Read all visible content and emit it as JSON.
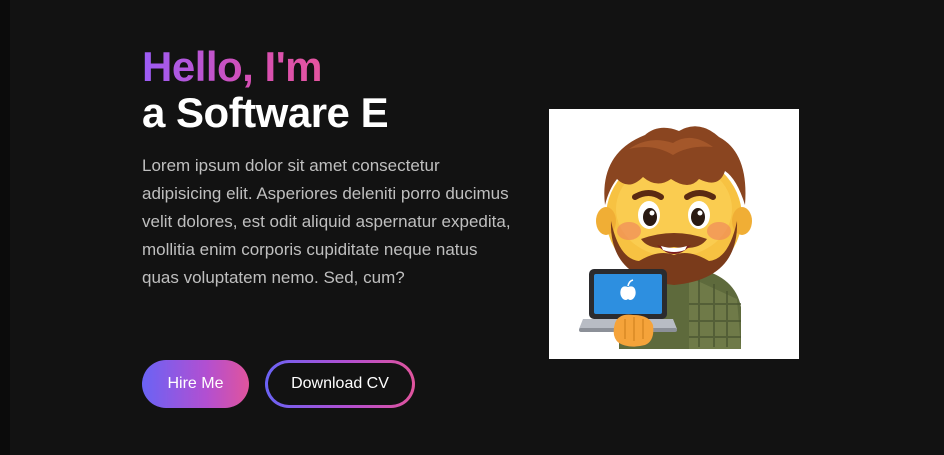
{
  "hero": {
    "greeting": "Hello, I'm",
    "role": "a Software E",
    "intro": "Lorem ipsum dolor sit amet consectetur adipisicing elit. Asperiores deleniti porro ducimus velit dolores, est odit aliquid aspernatur expedita, mollitia enim corporis cupiditate neque natus quas voluptatem nemo. Sed, cum?"
  },
  "actions": {
    "hire_label": "Hire Me",
    "cv_label": "Download CV"
  },
  "avatar": {
    "icon": "developer-emoji-avatar"
  },
  "colors": {
    "background": "#121212",
    "gradient_start": "#9b5cf6",
    "gradient_end": "#e4559f",
    "body_text": "#bfbfbf"
  }
}
